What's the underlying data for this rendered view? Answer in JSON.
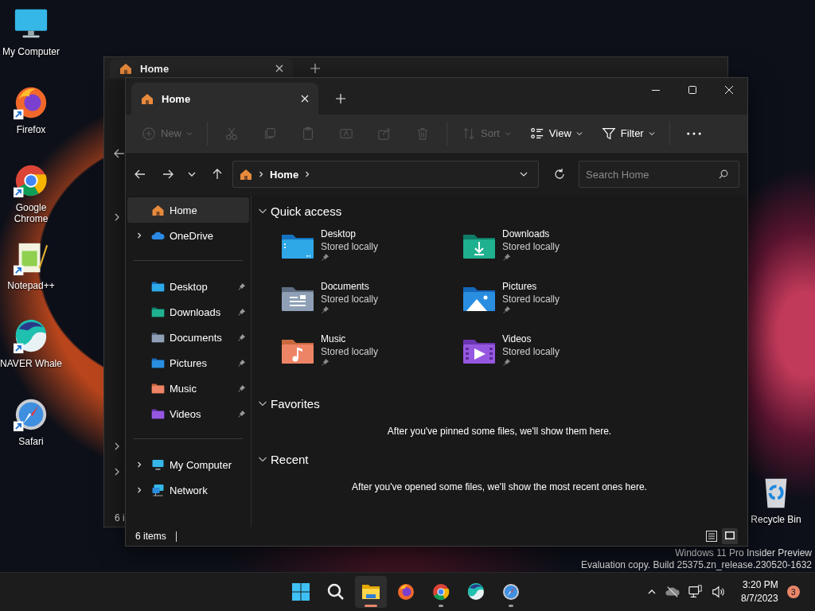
{
  "desktop_icons": [
    {
      "label": "My Computer",
      "kind": "computer",
      "shortcut": false
    },
    {
      "label": "Firefox",
      "kind": "firefox",
      "shortcut": true
    },
    {
      "label": "Google Chrome",
      "kind": "chrome",
      "shortcut": true
    },
    {
      "label": "Notepad++",
      "kind": "notepad",
      "shortcut": true
    },
    {
      "label": "NAVER Whale",
      "kind": "whale",
      "shortcut": true
    },
    {
      "label": "Safari",
      "kind": "safari",
      "shortcut": true
    }
  ],
  "recycle_bin": {
    "label": "Recycle Bin"
  },
  "back_window": {
    "tab": "Home",
    "status": "6 i"
  },
  "window": {
    "tabs": [
      {
        "label": "Home",
        "selected": true
      }
    ],
    "toolbar": [
      {
        "kind": "new",
        "label": "New",
        "menu": true,
        "disabled": true
      },
      {
        "kind": "divider"
      },
      {
        "kind": "cut",
        "disabled": true
      },
      {
        "kind": "copy",
        "disabled": true
      },
      {
        "kind": "paste",
        "disabled": true
      },
      {
        "kind": "rename",
        "disabled": true
      },
      {
        "kind": "share",
        "disabled": true
      },
      {
        "kind": "delete",
        "disabled": true
      },
      {
        "kind": "divider"
      },
      {
        "kind": "sort",
        "label": "Sort",
        "menu": true,
        "disabled": true
      },
      {
        "kind": "view",
        "label": "View",
        "menu": true,
        "disabled": false
      },
      {
        "kind": "filter",
        "label": "Filter",
        "menu": true,
        "disabled": false
      },
      {
        "kind": "divider"
      },
      {
        "kind": "more",
        "disabled": false
      }
    ],
    "address": {
      "crumbs": [
        "Home"
      ]
    },
    "search": {
      "placeholder": "Search Home"
    },
    "sidebar": {
      "groups": [
        {
          "items": [
            {
              "label": "Home",
              "kind": "home",
              "selected": true,
              "expandable": false,
              "pinned": false
            },
            {
              "label": "OneDrive",
              "kind": "cloud",
              "selected": false,
              "expandable": true,
              "pinned": false
            }
          ]
        },
        {
          "items": [
            {
              "label": "Desktop",
              "kind": "desktop",
              "selected": false,
              "expandable": false,
              "pinned": true
            },
            {
              "label": "Downloads",
              "kind": "downloads",
              "selected": false,
              "expandable": false,
              "pinned": true
            },
            {
              "label": "Documents",
              "kind": "documents",
              "selected": false,
              "expandable": false,
              "pinned": true
            },
            {
              "label": "Pictures",
              "kind": "pictures",
              "selected": false,
              "expandable": false,
              "pinned": true
            },
            {
              "label": "Music",
              "kind": "music",
              "selected": false,
              "expandable": false,
              "pinned": true
            },
            {
              "label": "Videos",
              "kind": "videos",
              "selected": false,
              "expandable": false,
              "pinned": true
            }
          ]
        },
        {
          "items": [
            {
              "label": "My Computer",
              "kind": "computer",
              "selected": false,
              "expandable": true,
              "pinned": false
            },
            {
              "label": "Network",
              "kind": "network",
              "selected": false,
              "expandable": true,
              "pinned": false
            }
          ]
        }
      ]
    },
    "sections": [
      {
        "title": "Quick access",
        "expanded": true,
        "items": [
          {
            "name": "Desktop",
            "detail": "Stored locally",
            "kind": "desktop",
            "pinned": true
          },
          {
            "name": "Downloads",
            "detail": "Stored locally",
            "kind": "downloads",
            "pinned": true
          },
          {
            "name": "Documents",
            "detail": "Stored locally",
            "kind": "documents",
            "pinned": true
          },
          {
            "name": "Pictures",
            "detail": "Stored locally",
            "kind": "pictures",
            "pinned": true
          },
          {
            "name": "Music",
            "detail": "Stored locally",
            "kind": "music",
            "pinned": true
          },
          {
            "name": "Videos",
            "detail": "Stored locally",
            "kind": "videos",
            "pinned": true
          }
        ]
      },
      {
        "title": "Favorites",
        "expanded": true,
        "message": "After you've pinned some files, we'll show them here."
      },
      {
        "title": "Recent",
        "expanded": true,
        "message": "After you've opened some files, we'll show the most recent ones here."
      }
    ],
    "status": {
      "count": "6 items",
      "views": [
        {
          "kind": "details",
          "selected": false
        },
        {
          "kind": "tiles",
          "selected": true
        }
      ]
    }
  },
  "system_notice": [
    "Windows 11 Pro Insider Preview",
    "Evaluation copy. Build 25375.zn_release.230520-1632"
  ],
  "taskbar": {
    "apps": [
      {
        "kind": "start",
        "selected": false,
        "running": false
      },
      {
        "kind": "search",
        "selected": false,
        "running": false
      },
      {
        "kind": "explorer",
        "selected": true,
        "running": true
      },
      {
        "kind": "firefox",
        "selected": false,
        "running": false
      },
      {
        "kind": "chrome",
        "selected": false,
        "running": true
      },
      {
        "kind": "whale",
        "selected": false,
        "running": false
      },
      {
        "kind": "safari",
        "selected": false,
        "running": true
      }
    ],
    "tray": {
      "time": "3:20 PM",
      "date": "8/7/2023",
      "badge": "3"
    }
  }
}
